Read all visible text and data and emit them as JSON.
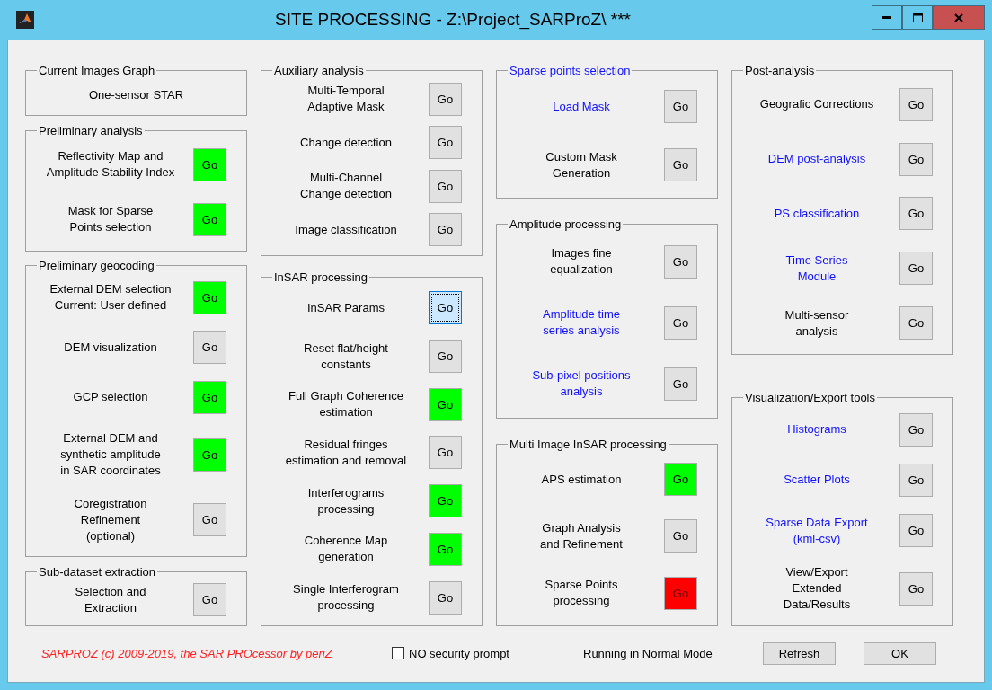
{
  "window": {
    "title": "SITE PROCESSING - Z:\\Project_SARProZ\\ ***"
  },
  "columns": [
    {
      "groups": [
        {
          "title": "Current Images Graph",
          "highlighted": false,
          "rows": [
            {
              "kind": "text",
              "label": "One-sensor STAR"
            }
          ]
        },
        {
          "title": "Preliminary analysis",
          "highlighted": false,
          "rows": [
            {
              "kind": "action",
              "label": "Reflectivity Map and\nAmplitude Stability Index",
              "highlighted": false,
              "button": "Go",
              "color": "#00ff00",
              "focused": false
            },
            {
              "kind": "action",
              "label": "Mask for Sparse\nPoints selection",
              "highlighted": false,
              "button": "Go",
              "color": "#00ff00",
              "focused": false
            }
          ]
        },
        {
          "title": "Preliminary geocoding",
          "highlighted": false,
          "rows": [
            {
              "kind": "action",
              "label": "External DEM selection\nCurrent: User defined",
              "highlighted": false,
              "button": "Go",
              "color": "#00ff00",
              "focused": false
            },
            {
              "kind": "action",
              "label": "DEM visualization",
              "highlighted": false,
              "button": "Go",
              "color": "#e1e1e1",
              "focused": false
            },
            {
              "kind": "action",
              "label": "GCP selection",
              "highlighted": false,
              "button": "Go",
              "color": "#00ff00",
              "focused": false
            },
            {
              "kind": "action",
              "label": "External DEM and\nsynthetic amplitude\nin SAR coordinates",
              "highlighted": false,
              "button": "Go",
              "color": "#00ff00",
              "focused": false
            },
            {
              "kind": "action",
              "label": "Coregistration\nRefinement\n(optional)",
              "highlighted": false,
              "button": "Go",
              "color": "#e1e1e1",
              "focused": false
            }
          ]
        },
        {
          "title": "Sub-dataset extraction",
          "highlighted": false,
          "rows": [
            {
              "kind": "action",
              "label": "Selection and\nExtraction",
              "highlighted": false,
              "button": "Go",
              "color": "#e1e1e1",
              "focused": false
            }
          ]
        }
      ]
    },
    {
      "groups": [
        {
          "title": "Auxiliary analysis",
          "highlighted": false,
          "rows": [
            {
              "kind": "action",
              "label": "Multi-Temporal\nAdaptive Mask",
              "highlighted": false,
              "button": "Go",
              "color": "#e1e1e1",
              "focused": false
            },
            {
              "kind": "action",
              "label": "Change detection",
              "highlighted": false,
              "button": "Go",
              "color": "#e1e1e1",
              "focused": false
            },
            {
              "kind": "action",
              "label": "Multi-Channel\nChange detection",
              "highlighted": false,
              "button": "Go",
              "color": "#e1e1e1",
              "focused": false
            },
            {
              "kind": "action",
              "label": "Image classification",
              "highlighted": false,
              "button": "Go",
              "color": "#e1e1e1",
              "focused": false
            }
          ]
        },
        {
          "title": "InSAR processing",
          "highlighted": false,
          "rows": [
            {
              "kind": "action",
              "label": "InSAR Params",
              "highlighted": false,
              "button": "Go",
              "color": "#cce8ff",
              "focused": true
            },
            {
              "kind": "action",
              "label": "Reset flat/height\nconstants",
              "highlighted": false,
              "button": "Go",
              "color": "#e1e1e1",
              "focused": false
            },
            {
              "kind": "action",
              "label": "Full Graph Coherence\nestimation",
              "highlighted": false,
              "button": "Go",
              "color": "#00ff00",
              "focused": false
            },
            {
              "kind": "action",
              "label": "Residual fringes\nestimation and removal",
              "highlighted": false,
              "button": "Go",
              "color": "#e1e1e1",
              "focused": false
            },
            {
              "kind": "action",
              "label": "Interferograms\nprocessing",
              "highlighted": false,
              "button": "Go",
              "color": "#00ff00",
              "focused": false
            },
            {
              "kind": "action",
              "label": "Coherence Map\ngeneration",
              "highlighted": false,
              "button": "Go",
              "color": "#00ff00",
              "focused": false
            },
            {
              "kind": "action",
              "label": "Single Interferogram\nprocessing",
              "highlighted": false,
              "button": "Go",
              "color": "#e1e1e1",
              "focused": false
            }
          ]
        }
      ]
    },
    {
      "groups": [
        {
          "title": "Sparse points selection",
          "highlighted": true,
          "rows": [
            {
              "kind": "action",
              "label": "Load Mask",
              "highlighted": true,
              "button": "Go",
              "color": "#e1e1e1",
              "focused": false
            },
            {
              "kind": "action",
              "label": "Custom Mask\nGeneration",
              "highlighted": false,
              "button": "Go",
              "color": "#e1e1e1",
              "focused": false
            }
          ]
        },
        {
          "title": "Amplitude processing",
          "highlighted": false,
          "rows": [
            {
              "kind": "action",
              "label": "Images fine\nequalization",
              "highlighted": false,
              "button": "Go",
              "color": "#e1e1e1",
              "focused": false
            },
            {
              "kind": "action",
              "label": "Amplitude time\nseries analysis",
              "highlighted": true,
              "button": "Go",
              "color": "#e1e1e1",
              "focused": false
            },
            {
              "kind": "action",
              "label": "Sub-pixel positions\nanalysis",
              "highlighted": true,
              "button": "Go",
              "color": "#e1e1e1",
              "focused": false
            }
          ]
        },
        {
          "title": "Multi Image InSAR processing",
          "highlighted": false,
          "rows": [
            {
              "kind": "action",
              "label": "APS estimation",
              "highlighted": false,
              "button": "Go",
              "color": "#00ff00",
              "focused": false
            },
            {
              "kind": "action",
              "label": "Graph Analysis\nand Refinement",
              "highlighted": false,
              "button": "Go",
              "color": "#e1e1e1",
              "focused": false
            },
            {
              "kind": "action",
              "label": "Sparse Points\nprocessing",
              "highlighted": false,
              "button": "Go",
              "color": "#ff0000",
              "focused": false
            }
          ]
        }
      ]
    },
    {
      "groups": [
        {
          "title": "Post-analysis",
          "highlighted": false,
          "rows": [
            {
              "kind": "action",
              "label": "Geografic Corrections",
              "highlighted": false,
              "button": "Go",
              "color": "#e1e1e1",
              "focused": false
            },
            {
              "kind": "action",
              "label": "DEM post-analysis",
              "highlighted": true,
              "button": "Go",
              "color": "#e1e1e1",
              "focused": false
            },
            {
              "kind": "action",
              "label": "PS classification",
              "highlighted": true,
              "button": "Go",
              "color": "#e1e1e1",
              "focused": false
            },
            {
              "kind": "action",
              "label": "Time Series\nModule",
              "highlighted": true,
              "button": "Go",
              "color": "#e1e1e1",
              "focused": false
            },
            {
              "kind": "action",
              "label": "Multi-sensor\nanalysis",
              "highlighted": false,
              "button": "Go",
              "color": "#e1e1e1",
              "focused": false
            }
          ]
        },
        {
          "title": "Visualization/Export tools",
          "highlighted": false,
          "rows": [
            {
              "kind": "action",
              "label": "Histograms",
              "highlighted": true,
              "button": "Go",
              "color": "#e1e1e1",
              "focused": false
            },
            {
              "kind": "action",
              "label": "Scatter Plots",
              "highlighted": true,
              "button": "Go",
              "color": "#e1e1e1",
              "focused": false
            },
            {
              "kind": "action",
              "label": "Sparse Data Export\n(kml-csv)",
              "highlighted": true,
              "button": "Go",
              "color": "#e1e1e1",
              "focused": false
            },
            {
              "kind": "action",
              "label": "View/Export\nExtended\nData/Results",
              "highlighted": false,
              "button": "Go",
              "color": "#e1e1e1",
              "focused": false
            }
          ]
        }
      ]
    }
  ],
  "footer": {
    "credit": "SARPROZ (c) 2009-2019, the SAR PROcessor by periZ",
    "security_prompt": {
      "label": "NO security prompt",
      "checked": false
    },
    "status": "Running in Normal Mode",
    "buttons": [
      "Refresh",
      "OK"
    ]
  }
}
